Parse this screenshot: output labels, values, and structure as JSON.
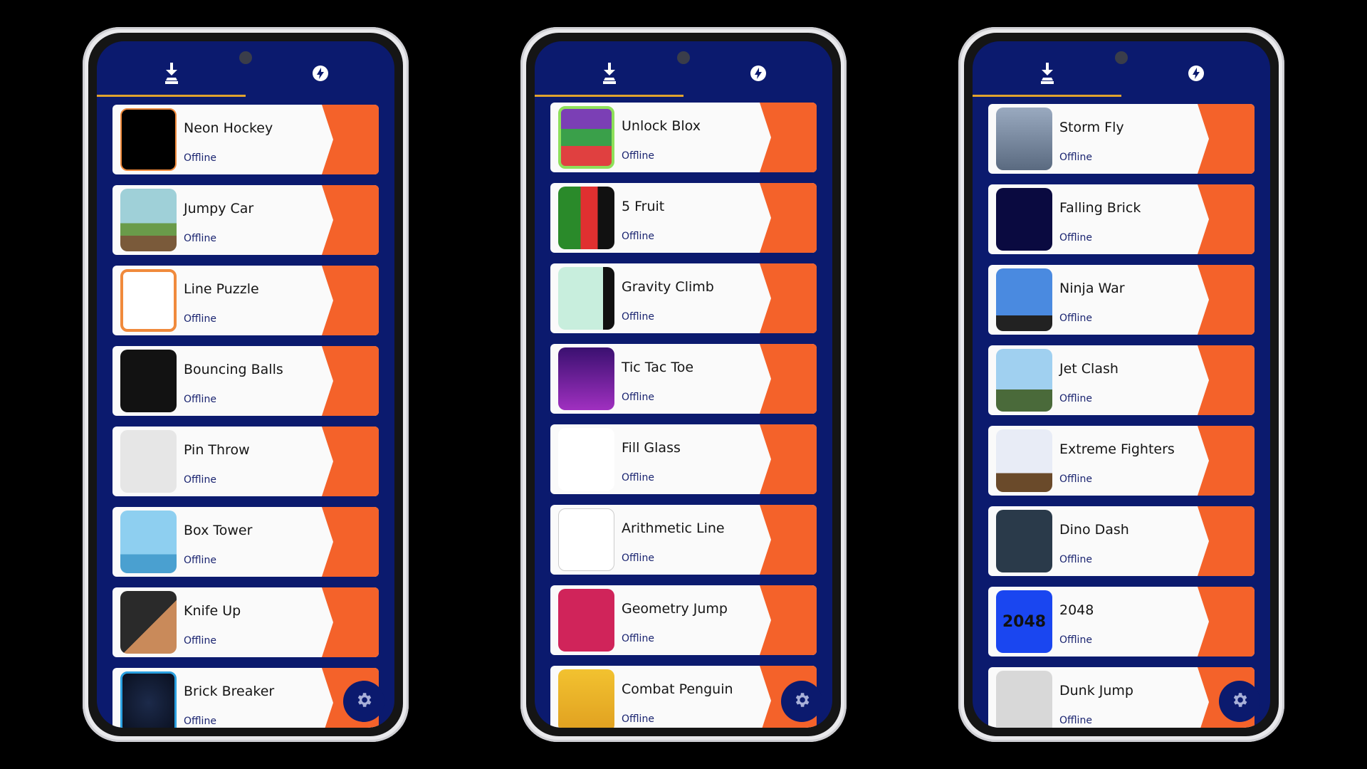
{
  "colors": {
    "background": "#0b1a6e",
    "accent": "#f4622a",
    "tab_indicator": "#e0a32e",
    "status_text": "#1a2470"
  },
  "tabs": [
    {
      "name": "downloaded",
      "icon": "download-icon",
      "active": true
    },
    {
      "name": "instant",
      "icon": "lightning-icon",
      "active": false
    }
  ],
  "fab": {
    "icon": "gear-icon"
  },
  "phones": [
    {
      "games": [
        {
          "title": "Neon Hockey",
          "status": "Offline",
          "icon": "neon-hockey"
        },
        {
          "title": "Jumpy Car",
          "status": "Offline",
          "icon": "jumpy-car"
        },
        {
          "title": "Line Puzzle",
          "status": "Offline",
          "icon": "line-puzzle"
        },
        {
          "title": "Bouncing Balls",
          "status": "Offline",
          "icon": "bouncing-balls"
        },
        {
          "title": "Pin Throw",
          "status": "Offline",
          "icon": "pin-throw"
        },
        {
          "title": "Box Tower",
          "status": "Offline",
          "icon": "box-tower"
        },
        {
          "title": "Knife Up",
          "status": "Offline",
          "icon": "knife-up"
        },
        {
          "title": "Brick Breaker",
          "status": "Offline",
          "icon": "brick-breaker"
        }
      ]
    },
    {
      "games": [
        {
          "title": "Unlock Blox",
          "status": "Offline",
          "icon": "unlock-blox"
        },
        {
          "title": "5 Fruit",
          "status": "Offline",
          "icon": "five-fruit"
        },
        {
          "title": "Gravity Climb",
          "status": "Offline",
          "icon": "gravity-climb"
        },
        {
          "title": "Tic Tac Toe",
          "status": "Offline",
          "icon": "tic-tac-toe"
        },
        {
          "title": "Fill Glass",
          "status": "Offline",
          "icon": "fill-glass"
        },
        {
          "title": "Arithmetic Line",
          "status": "Offline",
          "icon": "arithmetic-line"
        },
        {
          "title": "Geometry Jump",
          "status": "Offline",
          "icon": "geometry-jump"
        },
        {
          "title": "Combat Penguin",
          "status": "Offline",
          "icon": "combat-penguin"
        }
      ]
    },
    {
      "games": [
        {
          "title": "Storm Fly",
          "status": "Offline",
          "icon": "storm-fly"
        },
        {
          "title": "Falling Brick",
          "status": "Offline",
          "icon": "falling-brick"
        },
        {
          "title": "Ninja War",
          "status": "Offline",
          "icon": "ninja-war"
        },
        {
          "title": "Jet Clash",
          "status": "Offline",
          "icon": "jet-clash"
        },
        {
          "title": "Extreme Fighters",
          "status": "Offline",
          "icon": "extreme-fighters"
        },
        {
          "title": "Dino Dash",
          "status": "Offline",
          "icon": "dino-dash"
        },
        {
          "title": "2048",
          "status": "Offline",
          "icon": "t2048",
          "logo_text": "2048"
        },
        {
          "title": "Dunk Jump",
          "status": "Offline",
          "icon": "dunk-jump"
        }
      ]
    }
  ]
}
